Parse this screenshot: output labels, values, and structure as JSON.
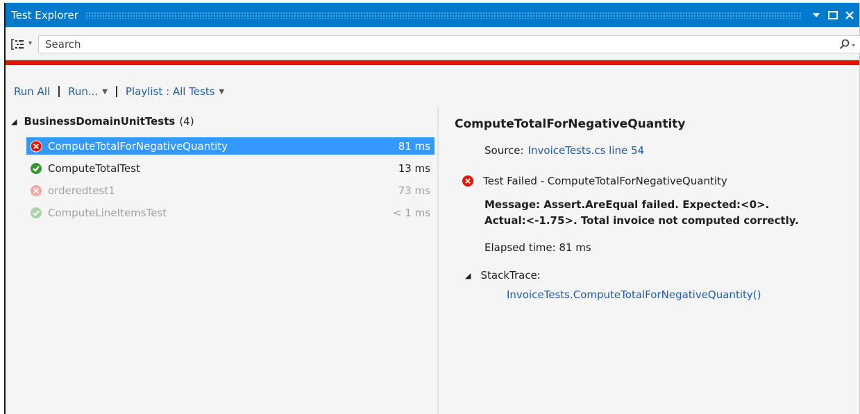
{
  "window": {
    "title": "Test Explorer",
    "menu_icon": "dropdown-triangle-icon",
    "restore_icon": "restore-icon",
    "close_icon": "close-icon",
    "title_color": "#007acc"
  },
  "toolbar": {
    "group_by_icon": "group-by-icon",
    "search_placeholder": "Search",
    "search_icon": "search-icon",
    "status_bar_color": "#e51400"
  },
  "commands": {
    "run_all": "Run All",
    "run": "Run...",
    "playlist": "Playlist : All Tests"
  },
  "tests": {
    "group_name": "BusinessDomainUnitTests",
    "group_count": "(4)",
    "items": [
      {
        "name": "ComputeTotalForNegativeQuantity",
        "time": "81 ms",
        "status": "failed"
      },
      {
        "name": "ComputeTotalTest",
        "time": "13 ms",
        "status": "passed"
      },
      {
        "name": "orderedtest1",
        "time": "73 ms",
        "status": "failed-stale"
      },
      {
        "name": "ComputeLineItemsTest",
        "time": "< 1 ms",
        "status": "passed-stale"
      }
    ]
  },
  "details": {
    "title": "ComputeTotalForNegativeQuantity",
    "source_label": "Source:",
    "source_link": "InvoiceTests.cs line 54",
    "result": "Test Failed - ComputeTotalForNegativeQuantity",
    "message_line1": "Message: Assert.AreEqual failed. Expected:<0>.",
    "message_line2": "Actual:<-1.75>. Total invoice not computed correctly.",
    "elapsed": "Elapsed time: 81 ms",
    "stacktrace_label": "StackTrace:",
    "stacktrace_link": "InvoiceTests.ComputeTotalForNegativeQuantity()"
  },
  "colors": {
    "selection": "#3399ff",
    "failed": "#e51400",
    "passed": "#339933",
    "link": "#1e5ba8"
  }
}
